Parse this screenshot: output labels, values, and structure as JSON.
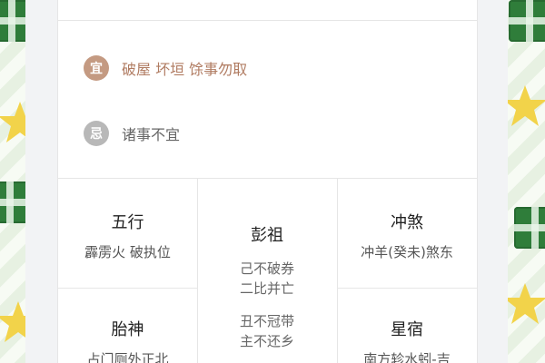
{
  "fortune": {
    "yi": {
      "badge": "宜",
      "text": "破屋 坏垣 馀事勿取"
    },
    "ji": {
      "badge": "忌",
      "text": "诸事不宜"
    }
  },
  "grid": {
    "wuxing": {
      "title": "五行",
      "value": "霹雳火 破执位"
    },
    "pengzu": {
      "title": "彭祖",
      "line1": "己不破券",
      "line2": "二比并亡",
      "line3": "丑不冠带",
      "line4": "主不还乡"
    },
    "chongsha": {
      "title": "冲煞",
      "value": "冲羊(癸未)煞东"
    },
    "taishen": {
      "title": "胎神",
      "value": "占门厕外正北"
    },
    "xingxiu": {
      "title": "星宿",
      "value": "南方轸水蚓-吉"
    }
  },
  "colors": {
    "yi_badge": "#c49a82",
    "ji_badge": "#b8b8b8",
    "gift_green": "#2f7d3a",
    "star_yellow": "#f2d34a"
  }
}
